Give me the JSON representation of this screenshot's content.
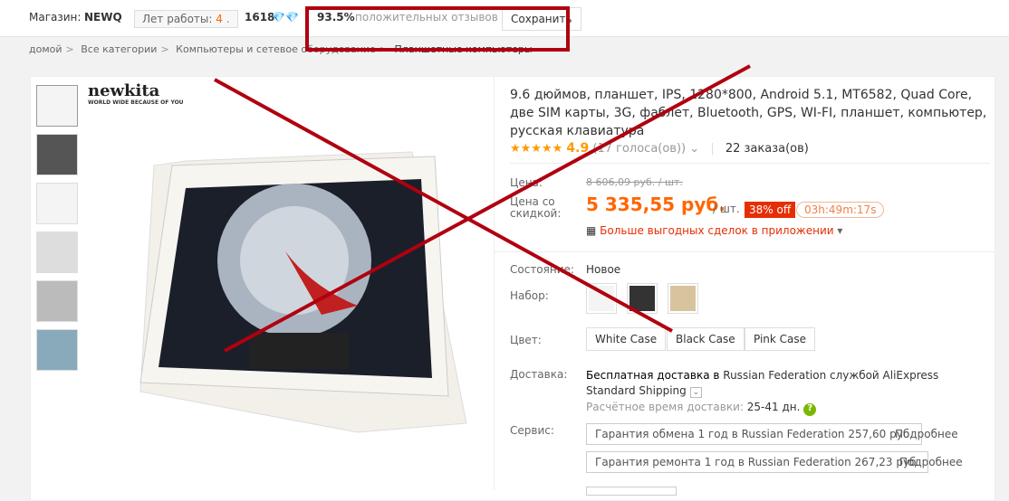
{
  "store": {
    "label": "Магазин:",
    "name": "NEWQ",
    "years_label": "Лет работы:",
    "years_value": "4 .",
    "score": "1618",
    "feedback_percent": "93.5%",
    "feedback_label": "положительных отзывов",
    "save_label": "Сохранить"
  },
  "breadcrumb": [
    "домой",
    "Все категории",
    "Компьютеры и сетевое оборудование",
    "Планшетные компьютеры"
  ],
  "gallery": {
    "logo_text": "newkita",
    "logo_sub": "WORLD WIDE BECAUSE OF YOU",
    "thumbnail_count": 6
  },
  "product": {
    "title": "9.6 дюймов, планшет, IPS, 1280*800, Android 5.1, MT6582, Quad Core, две SIM карты, 3G, фаблет, Bluetooth, GPS, WI-FI, планшет, компьютер, русская клавиатура",
    "rating": "4.9",
    "votes": "(17 голоса(ов))",
    "orders": "22 заказа(ов)",
    "price_label": "Цена:",
    "old_price": "8 606,09 руб. / шт.",
    "discount_label": "Цена со скидкой:",
    "price": "5 335,55 руб.",
    "unit": "/ шт.",
    "discount": "38% off",
    "timer": "03h:49m:17s",
    "app_deals": "Больше выгодных сделок в приложении",
    "condition_label": "Состояние:",
    "condition": "Новое",
    "set_label": "Набор:",
    "color_label": "Цвет:",
    "colors": [
      "White Case",
      "Black Case",
      "Pink Case"
    ],
    "shipping_label": "Доставка:",
    "shipping_bold": "Бесплатная доставка в",
    "shipping_rest": "Russian Federation службой AliExpress Standard Shipping",
    "delivery_label": "Расчётное время доставки:",
    "delivery_value": "25-41 дн.",
    "service_label": "Сервис:",
    "services": [
      {
        "text": "Гарантия обмена 1 год в Russian Federation 257,60 руб.",
        "more": "Подробнее"
      },
      {
        "text": "Гарантия ремонта 1 год в Russian Federation 267,23 руб.",
        "more": "Подробнее"
      }
    ]
  },
  "colors": {
    "accent": "#ff6600",
    "annotation": "#b00010",
    "sale": "#e62e04"
  }
}
